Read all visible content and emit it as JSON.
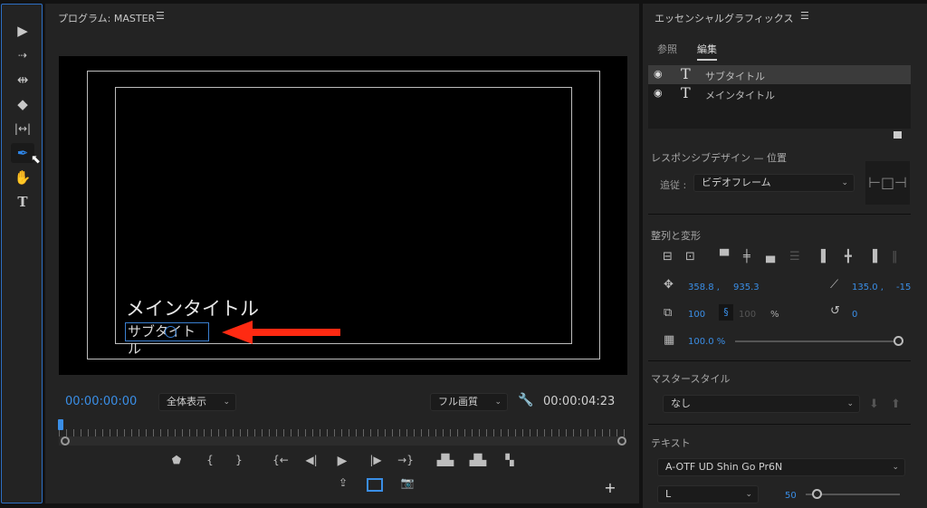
{
  "program": {
    "title": "プログラム: MASTER",
    "timecode_current": "00:00:00:00",
    "zoom": "全体表示",
    "quality": "フル画質",
    "timecode_duration": "00:00:04:23",
    "main_title": "メインタイトル",
    "sub_title": "サブタイトル"
  },
  "essential": {
    "title": "エッセンシャルグラフィックス",
    "tabs": [
      "参照",
      "編集"
    ],
    "layers": [
      "サブタイトル",
      "メインタイトル"
    ],
    "responsive": {
      "label": "レスポンシブデザイン — 位置",
      "follow_label": "追従 :",
      "follow_value": "ビデオフレーム"
    },
    "transform": {
      "label": "整列と変形",
      "pos_x": "358.8 ,",
      "pos_y": "935.3",
      "anchor_x": "135.0 ,",
      "anchor_y": "-15",
      "scale": "100",
      "scale_h": "100",
      "pct": "%",
      "rotation": "0",
      "opacity": "100.0 %",
      "opacity_fraction": 1.0
    },
    "master": {
      "label": "マスタースタイル",
      "value": "なし"
    },
    "text": {
      "label": "テキスト",
      "font": "A-OTF UD Shin Go Pr6N",
      "weight": "L",
      "size": "50"
    }
  },
  "colors": {
    "accent": "#3a8ee6",
    "arrow": "#ff2a12"
  }
}
